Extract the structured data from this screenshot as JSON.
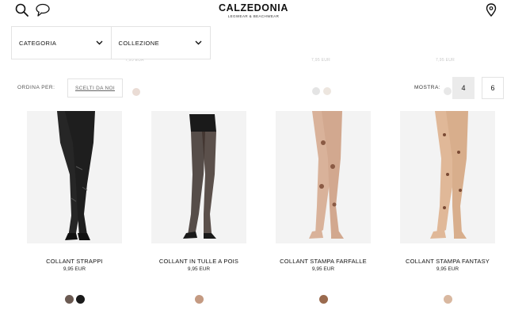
{
  "header": {
    "brand_name": "CALZEDONIA",
    "brand_tagline": "LEGWEAR & BEACHWEAR",
    "icons": [
      "search-icon",
      "chat-icon",
      "location-pin-icon"
    ]
  },
  "ghost_prices": [
    "7,95 EUR",
    "7,95 EUR",
    "7,95 EUR"
  ],
  "filters": [
    {
      "label": "CATEGORIA",
      "icon": "chevron-down-icon"
    },
    {
      "label": "COLLEZIONE",
      "icon": "chevron-down-icon"
    }
  ],
  "sort": {
    "label": "ORDINA PER:",
    "value": "SCELTI DA NOI"
  },
  "view": {
    "label": "MOSTRA:",
    "options": [
      "4",
      "6"
    ],
    "selected": "4"
  },
  "products": [
    {
      "name": "COLLANT STRAPPI",
      "price": "9,95 EUR",
      "swatches": [
        "#6b5a52",
        "#1a1a1a"
      ]
    },
    {
      "name": "COLLANT IN TULLE A POIS",
      "price": "9,95 EUR",
      "swatches": [
        "#c49a82"
      ]
    },
    {
      "name": "COLLANT STAMPA FARFALLE",
      "price": "9,95 EUR",
      "swatches": [
        "#9a6a4e"
      ]
    },
    {
      "name": "COLLANT STAMPA FANTASY",
      "price": "9,95 EUR",
      "swatches": [
        "#d9b8a0"
      ]
    }
  ],
  "colors": {
    "accent": "#ebebeb",
    "border": "#e3e3e3",
    "text": "#111111"
  }
}
